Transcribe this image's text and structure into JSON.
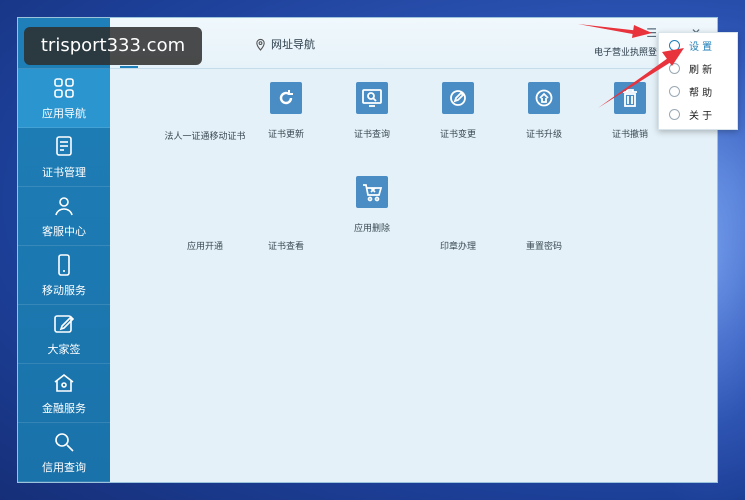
{
  "watermark": "trisport333.com",
  "sidebar": {
    "items": [
      {
        "label": "应用导航",
        "icon": "grid-icon",
        "active": true
      },
      {
        "label": "证书管理",
        "icon": "certificate-icon",
        "active": false
      },
      {
        "label": "客服中心",
        "icon": "user-icon",
        "active": false
      },
      {
        "label": "移动服务",
        "icon": "mobile-icon",
        "active": false
      },
      {
        "label": "大家签",
        "icon": "edit-icon",
        "active": false
      },
      {
        "label": "金融服务",
        "icon": "home-icon",
        "active": false
      },
      {
        "label": "信用查询",
        "icon": "search-icon",
        "active": false
      }
    ]
  },
  "header": {
    "url_tab": "网址导航",
    "right_text": "电子营业执照登",
    "controls": {
      "menu": "☰",
      "minimize": "—",
      "close": "✕"
    }
  },
  "tiles": [
    {
      "label": "法人一证通移动证书",
      "icon": "none"
    },
    {
      "label": "证书更新",
      "icon": "refresh-icon"
    },
    {
      "label": "证书查询",
      "icon": "monitor-search-icon"
    },
    {
      "label": "证书变更",
      "icon": "pen-icon"
    },
    {
      "label": "证书升级",
      "icon": "upgrade-icon"
    },
    {
      "label": "证书撤销",
      "icon": "trash-icon"
    },
    {
      "label": "应用开通",
      "icon": "none"
    },
    {
      "label": "证书查看",
      "icon": "none"
    },
    {
      "label": "应用删除",
      "icon": "cart-delete-icon"
    },
    {
      "label": "印章办理",
      "icon": "none"
    },
    {
      "label": "重置密码",
      "icon": "none"
    }
  ],
  "dropdown": {
    "items": [
      {
        "label": "设 置",
        "icon": "settings-icon"
      },
      {
        "label": "刷 新",
        "icon": "refresh-circle-icon"
      },
      {
        "label": "帮 助",
        "icon": "help-icon"
      },
      {
        "label": "关 于",
        "icon": "info-icon"
      }
    ]
  },
  "colors": {
    "accent": "#1f7fb8",
    "sidebar": "#1f7fb8",
    "active": "#2a95cf",
    "icon_tile": "#4a8dc4",
    "arrow": "#e8323c"
  }
}
